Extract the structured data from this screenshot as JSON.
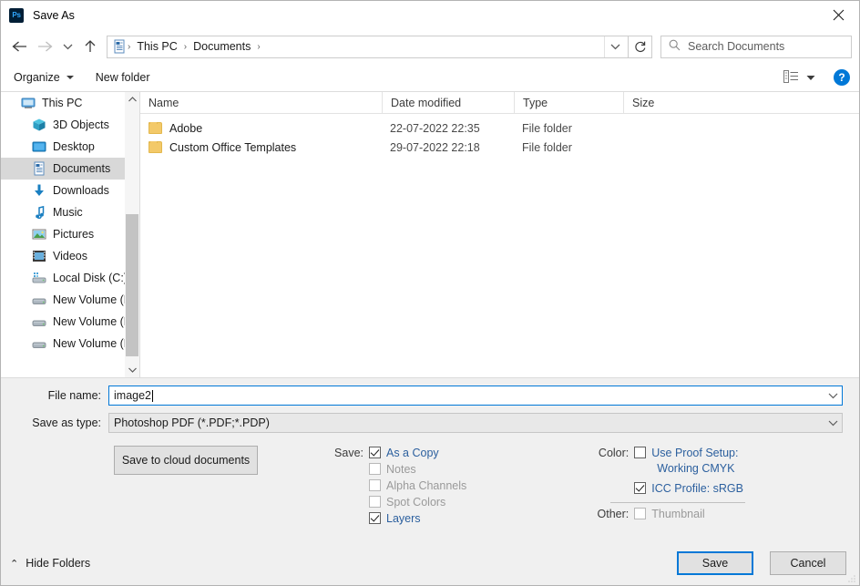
{
  "window": {
    "title": "Save As",
    "app_icon": "Ps",
    "close_label": "✕"
  },
  "nav": {
    "back_icon": "back-arrow-icon",
    "forward_icon": "forward-arrow-icon",
    "recent_icon": "chevron-down-icon",
    "up_icon": "up-arrow-icon",
    "refresh_icon": "refresh-icon",
    "breadcrumbs": [
      "This PC",
      "Documents"
    ],
    "separator": "›"
  },
  "search": {
    "placeholder": "Search Documents"
  },
  "toolbar": {
    "organize": "Organize",
    "new_folder": "New folder",
    "help_label": "?"
  },
  "sidebar": {
    "items": [
      {
        "label": "This PC",
        "icon": "monitor-icon",
        "indent": false,
        "selected": false
      },
      {
        "label": "3D Objects",
        "icon": "cube-icon",
        "indent": true,
        "selected": false
      },
      {
        "label": "Desktop",
        "icon": "desktop-icon",
        "indent": true,
        "selected": false
      },
      {
        "label": "Documents",
        "icon": "documents-icon",
        "indent": true,
        "selected": true
      },
      {
        "label": "Downloads",
        "icon": "download-arrow-icon",
        "indent": true,
        "selected": false
      },
      {
        "label": "Music",
        "icon": "music-note-icon",
        "indent": true,
        "selected": false
      },
      {
        "label": "Pictures",
        "icon": "picture-icon",
        "indent": true,
        "selected": false
      },
      {
        "label": "Videos",
        "icon": "video-icon",
        "indent": true,
        "selected": false
      },
      {
        "label": "Local Disk (C:)",
        "icon": "local-disk-icon",
        "indent": true,
        "selected": false
      },
      {
        "label": "New Volume (D:)",
        "icon": "drive-icon",
        "indent": true,
        "selected": false
      },
      {
        "label": "New Volume (E:)",
        "icon": "drive-icon",
        "indent": true,
        "selected": false
      },
      {
        "label": "New Volume (F:)",
        "icon": "drive-icon",
        "indent": true,
        "selected": false
      }
    ]
  },
  "filelist": {
    "columns": [
      "Name",
      "Date modified",
      "Type",
      "Size"
    ],
    "rows": [
      {
        "name": "Adobe",
        "date": "22-07-2022 22:35",
        "type": "File folder",
        "size": ""
      },
      {
        "name": "Custom Office Templates",
        "date": "29-07-2022 22:18",
        "type": "File folder",
        "size": ""
      }
    ]
  },
  "form": {
    "file_name_label": "File name:",
    "file_name_value": "image2",
    "save_as_type_label": "Save as type:",
    "save_as_type_value": "Photoshop PDF (*.PDF;*.PDP)"
  },
  "options": {
    "cloud_button": "Save to cloud documents",
    "save_label": "Save:",
    "save_items": [
      {
        "label": "As a Copy",
        "checked": true,
        "enabled": true
      },
      {
        "label": "Notes",
        "checked": false,
        "enabled": false
      },
      {
        "label": "Alpha Channels",
        "checked": false,
        "enabled": false
      },
      {
        "label": "Spot Colors",
        "checked": false,
        "enabled": false
      },
      {
        "label": "Layers",
        "checked": true,
        "enabled": true
      }
    ],
    "color_label": "Color:",
    "proof_setup": {
      "label": "Use Proof Setup:",
      "sub": "Working CMYK",
      "checked": false,
      "enabled": true
    },
    "icc_profile": {
      "label": "ICC Profile:  sRGB",
      "checked": true,
      "enabled": true
    },
    "other_label": "Other:",
    "thumbnail": {
      "label": "Thumbnail",
      "checked": false,
      "enabled": false
    }
  },
  "footer": {
    "hide_folders": "Hide Folders",
    "chevron": "⌃",
    "save_button": "Save",
    "cancel_button": "Cancel"
  },
  "colors": {
    "accent": "#0078d7",
    "link": "#2b5f9e",
    "selection": "#d8d8d8",
    "panel": "#f0f0f0",
    "folder": "#f3c969"
  }
}
